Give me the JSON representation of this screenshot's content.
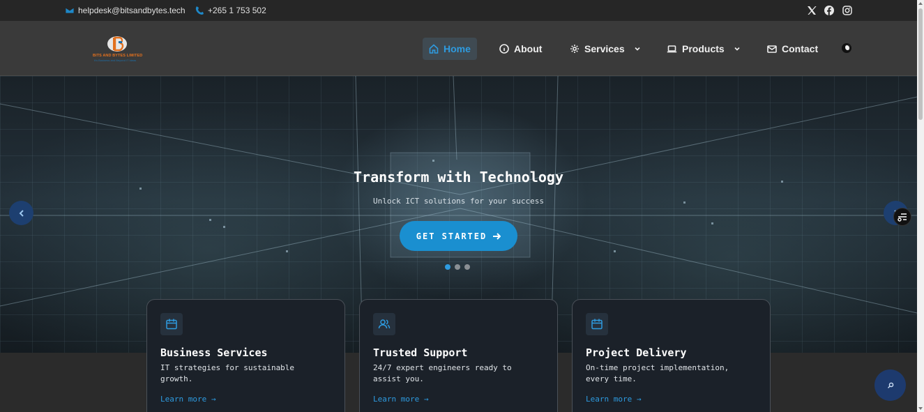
{
  "topbar": {
    "email": "helpdesk@bitsandbytes.tech",
    "phone": "+265 1 753 502",
    "social": [
      "x-icon",
      "facebook-icon",
      "instagram-icon"
    ]
  },
  "logo": {
    "name": "BITS AND BYTES LIMITED",
    "tagline": "It's Business and Beyond IT Ideas"
  },
  "nav": {
    "items": [
      {
        "label": "Home",
        "icon": "home-icon",
        "active": true
      },
      {
        "label": "About",
        "icon": "info-icon"
      },
      {
        "label": "Services",
        "icon": "gear-icon",
        "dropdown": true
      },
      {
        "label": "Products",
        "icon": "laptop-icon",
        "dropdown": true
      },
      {
        "label": "Contact",
        "icon": "mail-icon"
      }
    ],
    "theme_toggle_icon": "moon-icon"
  },
  "hero": {
    "title": "Transform with Technology",
    "subtitle": "Unlock ICT solutions for your success",
    "cta_label": "GET STARTED",
    "slides_count": 3,
    "active_slide": 1
  },
  "features": [
    {
      "icon": "calendar-icon",
      "title": "Business Services",
      "desc": "IT strategies for sustainable growth.",
      "link": "Learn more →"
    },
    {
      "icon": "users-icon",
      "title": "Trusted Support",
      "desc": "24/7 expert engineers ready to assist you.",
      "link": "Learn more →"
    },
    {
      "icon": "calendar-icon",
      "title": "Project Delivery",
      "desc": "On-time project implementation, every time.",
      "link": "Learn more →"
    }
  ],
  "colors": {
    "accent": "#2e9be0",
    "cta": "#1a8fd0",
    "logo_orange": "#e2701e"
  }
}
